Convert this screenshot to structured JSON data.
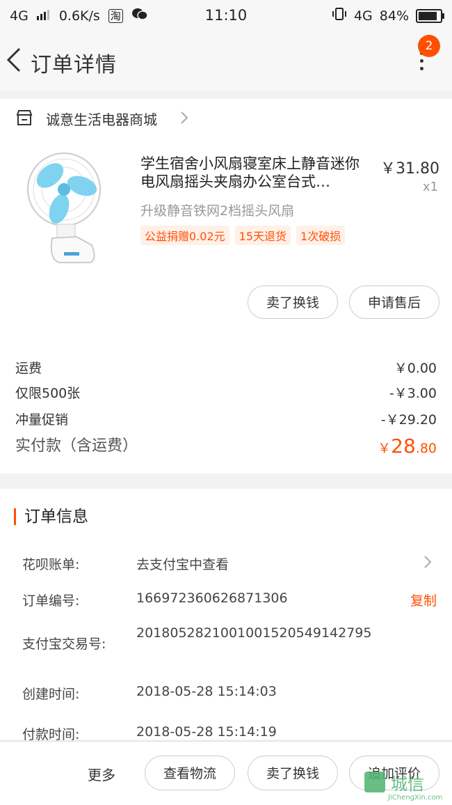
{
  "status_bar": {
    "network": "4G",
    "speed": "0.6K/s",
    "app_icon_1": "淘",
    "time": "11:10",
    "network_right": "4G",
    "battery": "84%"
  },
  "nav": {
    "title": "订单详情",
    "badge_count": "2"
  },
  "shop": {
    "name": "诚意生活电器商城",
    "product": {
      "title": "学生宿舍小风扇寝室床上静音迷你电风扇摇头夹扇办公室台式…",
      "price": "￥31.80",
      "qty": "x1",
      "spec": "升级静音铁网2档摇头风扇",
      "tags": [
        "公益捐赠0.02元",
        "15天退货",
        "1次破损"
      ]
    },
    "buttons": {
      "sell": "卖了换钱",
      "after_sale": "申请售后"
    },
    "fees": [
      {
        "label": "运费",
        "value": "￥0.00"
      },
      {
        "label": "仅限500张",
        "value": "-￥3.00"
      },
      {
        "label": "冲量促销",
        "value": "-￥29.20"
      }
    ],
    "total": {
      "label": "实付款（含运费）",
      "currency": "￥",
      "integer": "28",
      "decimal": ".80"
    }
  },
  "order_info": {
    "title": "订单信息",
    "rows": [
      {
        "label": "花呗账单:",
        "value": "去支付宝中查看"
      },
      {
        "label": "订单编号:",
        "value": "166972360626871306",
        "action": "复制"
      },
      {
        "label": "支付宝交易号:",
        "value": "2018052821001001520549142795"
      },
      {
        "label": "创建时间:",
        "value": "2018-05-28 15:14:03"
      },
      {
        "label": "付款时间:",
        "value": "2018-05-28 15:14:19"
      }
    ]
  },
  "bottom_bar": {
    "more": "更多",
    "buttons": [
      "查看物流",
      "卖了换钱",
      "追加评价"
    ]
  },
  "watermark": {
    "text": "城信",
    "subtext": "JiChengXin.com"
  },
  "colors": {
    "accent": "#ff5000",
    "tag_bg": "#fff0e8",
    "fan_blade": "#7fd3f0"
  }
}
